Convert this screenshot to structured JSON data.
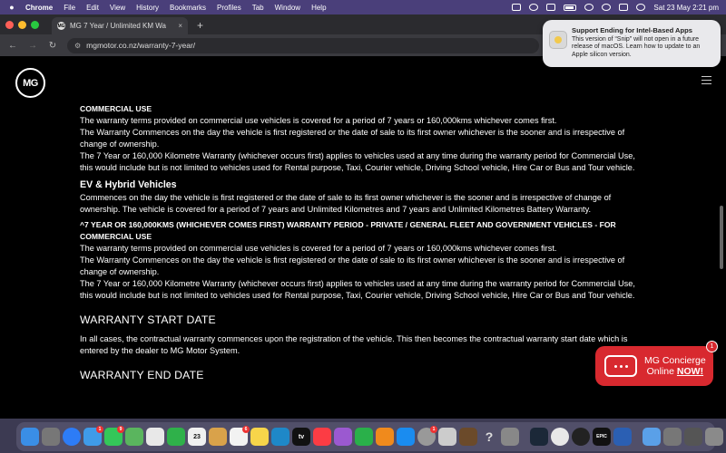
{
  "menubar": {
    "app": "Chrome",
    "items": [
      "File",
      "Edit",
      "View",
      "History",
      "Bookmarks",
      "Profiles",
      "Tab",
      "Window",
      "Help"
    ],
    "clock": "Sat 23 May  2:21 pm"
  },
  "tab": {
    "title": "MG 7 Year / Unlimited KM Wa",
    "close": "×",
    "new": "+"
  },
  "address": {
    "url": "mgmotor.co.nz/warranty-7-year/"
  },
  "notification": {
    "title": "Support Ending for Intel-Based Apps",
    "body": "This version of “Snip” will not open in a future release of macOS. Learn how to update to an Apple silicon version."
  },
  "site": {
    "logo": "MG"
  },
  "content": {
    "s1_heading": "COMMERCIAL USE",
    "s1_p1": "The warranty terms provided on commercial use vehicles is covered for a period of 7 years or 160,000kms whichever comes first.",
    "s1_p2": "The Warranty Commences on the day the vehicle is first registered or the date of sale to its first owner whichever is the sooner and is irrespective of change of ownership.",
    "s1_p3": "The 7 Year or 160,000 Kilometre Warranty (whichever occurs first) applies to vehicles used at any time during the warranty period for Commercial Use, this would include but is not limited to vehicles used for Rental purpose, Taxi, Courier vehicle, Driving School vehicle, Hire Car or Bus and Tour vehicle.",
    "ev_heading": "EV & Hybrid Vehicles",
    "ev_p": "Commences on the day the vehicle is first registered or the date of sale to its first owner whichever is the sooner and is irrespective of change of ownership. The vehicle is covered for a period of 7 years and Unlimited Kilometres and 7 years and Unlimited Kilometres Battery Warranty.",
    "s2_heading": "^7 YEAR OR 160,000KMS (WHICHEVER COMES FIRST) WARRANTY PERIOD - PRIVATE / GENERAL FLEET AND GOVERNMENT VEHICLES - FOR COMMERCIAL USE",
    "s2_p1": "The warranty terms provided on commercial use vehicles is covered for a period of 7 years or 160,000kms whichever comes first.",
    "s2_p2": "The Warranty Commences on the day the vehicle is first registered or the date of sale to its first owner whichever is the sooner and is irrespective of change of ownership.",
    "s2_p3": "The 7 Year or 160,000 Kilometre Warranty (whichever occurs first) applies to vehicles used at any time during the warranty period for Commercial Use, this would include but is not limited to vehicles used for Rental purpose, Taxi, Courier vehicle, Driving School vehicle, Hire Car or Bus and Tour vehicle.",
    "start_heading": "WARRANTY START DATE",
    "start_p": "In all cases, the contractual warranty commences upon the registration of the vehicle. This then becomes the contractual warranty start date which is entered by the dealer to MG Motor System.",
    "end_heading": "WARRANTY END DATE"
  },
  "concierge": {
    "line1": "MG Concierge",
    "line2_pre": "Online ",
    "line2_now": "NOW!",
    "badge": "1"
  },
  "dock": {
    "calendar_day": "23",
    "help": "?",
    "epic": "EPIC",
    "tv": "tv",
    "badges": {
      "mail": "1",
      "messages": "9",
      "reminders": "6",
      "calendar": "1"
    }
  },
  "colors": {
    "brand_red": "#d8292f",
    "menubar": "#4a3f7a"
  }
}
